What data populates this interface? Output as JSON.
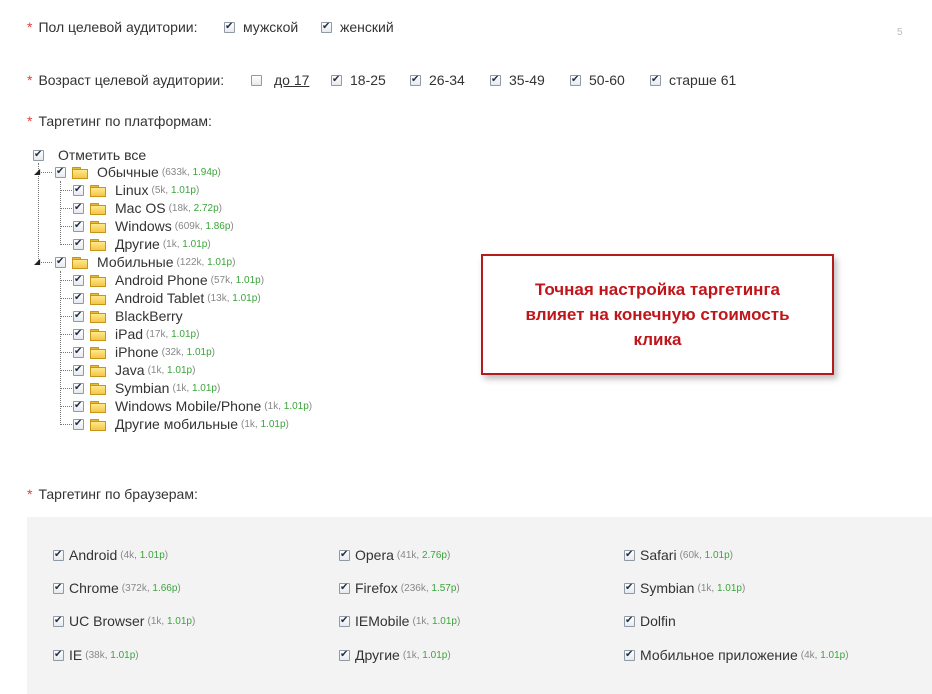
{
  "page_number": "5",
  "gender": {
    "label": "Пол целевой аудитории:",
    "options": [
      {
        "label": "мужской",
        "checked": true
      },
      {
        "label": "женский",
        "checked": true
      }
    ]
  },
  "age": {
    "label": "Возраст целевой аудитории:",
    "options": [
      {
        "label": "до 17",
        "checked": false,
        "link": true
      },
      {
        "label": "18-25",
        "checked": true
      },
      {
        "label": "26-34",
        "checked": true
      },
      {
        "label": "35-49",
        "checked": true
      },
      {
        "label": "50-60",
        "checked": true
      },
      {
        "label": "старше 61",
        "checked": true
      }
    ]
  },
  "platforms": {
    "label": "Таргетинг по платформам:",
    "select_all_label": "Отметить все",
    "groups": [
      {
        "name": "Обычные",
        "count": "633k",
        "price": "1.94р",
        "items": [
          {
            "name": "Linux",
            "count": "5k",
            "price": "1.01р"
          },
          {
            "name": "Mac OS",
            "count": "18k",
            "price": "2.72р"
          },
          {
            "name": "Windows",
            "count": "609k",
            "price": "1.86р"
          },
          {
            "name": "Другие",
            "count": "1k",
            "price": "1.01р"
          }
        ]
      },
      {
        "name": "Мобильные",
        "count": "122k",
        "price": "1.01р",
        "items": [
          {
            "name": "Android Phone",
            "count": "57k",
            "price": "1.01р"
          },
          {
            "name": "Android Tablet",
            "count": "13k",
            "price": "1.01р"
          },
          {
            "name": "BlackBerry",
            "count": "",
            "price": ""
          },
          {
            "name": "iPad",
            "count": "17k",
            "price": "1.01р"
          },
          {
            "name": "iPhone",
            "count": "32k",
            "price": "1.01р"
          },
          {
            "name": "Java",
            "count": "1k",
            "price": "1.01р"
          },
          {
            "name": "Symbian",
            "count": "1k",
            "price": "1.01р"
          },
          {
            "name": "Windows Mobile/Phone",
            "count": "1k",
            "price": "1.01р"
          },
          {
            "name": "Другие мобильные",
            "count": "1k",
            "price": "1.01р"
          }
        ]
      }
    ]
  },
  "callout": {
    "lines": [
      "Точная настройка таргетинга",
      "влияет на конечную стоимость",
      "клика"
    ],
    "border_color": "#b31c1c",
    "text_color": "#c0151a"
  },
  "browsers": {
    "label": "Таргетинг по браузерам:",
    "columns": [
      [
        {
          "name": "Android",
          "count": "4k",
          "price": "1.01р"
        },
        {
          "name": "Chrome",
          "count": "372k",
          "price": "1.66р"
        },
        {
          "name": "UC Browser",
          "count": "1k",
          "price": "1.01р"
        },
        {
          "name": "IE",
          "count": "38k",
          "price": "1.01р"
        }
      ],
      [
        {
          "name": "Opera",
          "count": "41k",
          "price": "2.76р"
        },
        {
          "name": "Firefox",
          "count": "236k",
          "price": "1.57р"
        },
        {
          "name": "IEMobile",
          "count": "1k",
          "price": "1.01р"
        },
        {
          "name": "Другие",
          "count": "1k",
          "price": "1.01р"
        }
      ],
      [
        {
          "name": "Safari",
          "count": "60k",
          "price": "1.01р"
        },
        {
          "name": "Symbian",
          "count": "1k",
          "price": "1.01р"
        },
        {
          "name": "Dolfin",
          "count": "",
          "price": ""
        },
        {
          "name": "Мобильное приложение",
          "count": "4k",
          "price": "1.01р"
        }
      ]
    ]
  },
  "colors": {
    "required_asterisk": "#e04040",
    "price_green": "#3aa53a",
    "panel_bg": "#f3f3f3"
  }
}
